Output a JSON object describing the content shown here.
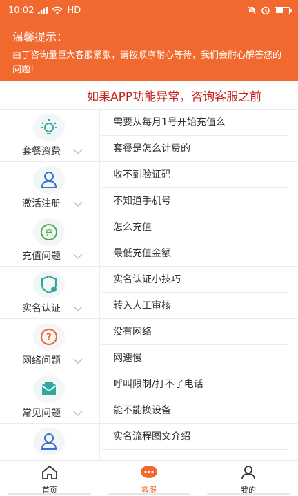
{
  "status_bar": {
    "time": "10:02",
    "network": "HD",
    "battery_level": 0.6
  },
  "notice": {
    "title": "温馨提示：",
    "body": "由于咨询量巨大客服紧张，请按顺序耐心等待，我们会耐心解答您的问题!"
  },
  "marquee": {
    "text": "如果APP功能异常，咨询客服之前"
  },
  "categories": [
    {
      "label": "套餐资费",
      "icon": "lightbulb-icon",
      "questions": [
        "需要从每月1号开始充值么",
        "套餐是怎么计费的"
      ]
    },
    {
      "label": "激活注册",
      "icon": "user-icon",
      "questions": [
        "收不到验证码",
        "不知道手机号"
      ]
    },
    {
      "label": "充值问题",
      "icon": "recharge-icon",
      "questions": [
        "怎么充值",
        "最低充值金额"
      ]
    },
    {
      "label": "实名认证",
      "icon": "shield-check-icon",
      "questions": [
        "实名认证小技巧",
        "转入人工审核"
      ]
    },
    {
      "label": "网络问题",
      "icon": "question-circle-icon",
      "questions": [
        "没有网络",
        "网速慢"
      ]
    },
    {
      "label": "常见问题",
      "icon": "mail-icon",
      "questions": [
        "呼叫限制/打不了电话",
        "能不能换设备"
      ]
    },
    {
      "label": "",
      "icon": "user-icon",
      "questions": [
        "实名流程图文介绍",
        ""
      ]
    }
  ],
  "tabs": [
    {
      "label": "首页",
      "icon": "home-icon",
      "active": false
    },
    {
      "label": "客服",
      "icon": "chat-icon",
      "active": true
    },
    {
      "label": "我的",
      "icon": "profile-icon",
      "active": false
    }
  ],
  "colors": {
    "accent": "#f1692e",
    "marquee": "#c1231b",
    "icon": "#2fa89e"
  }
}
